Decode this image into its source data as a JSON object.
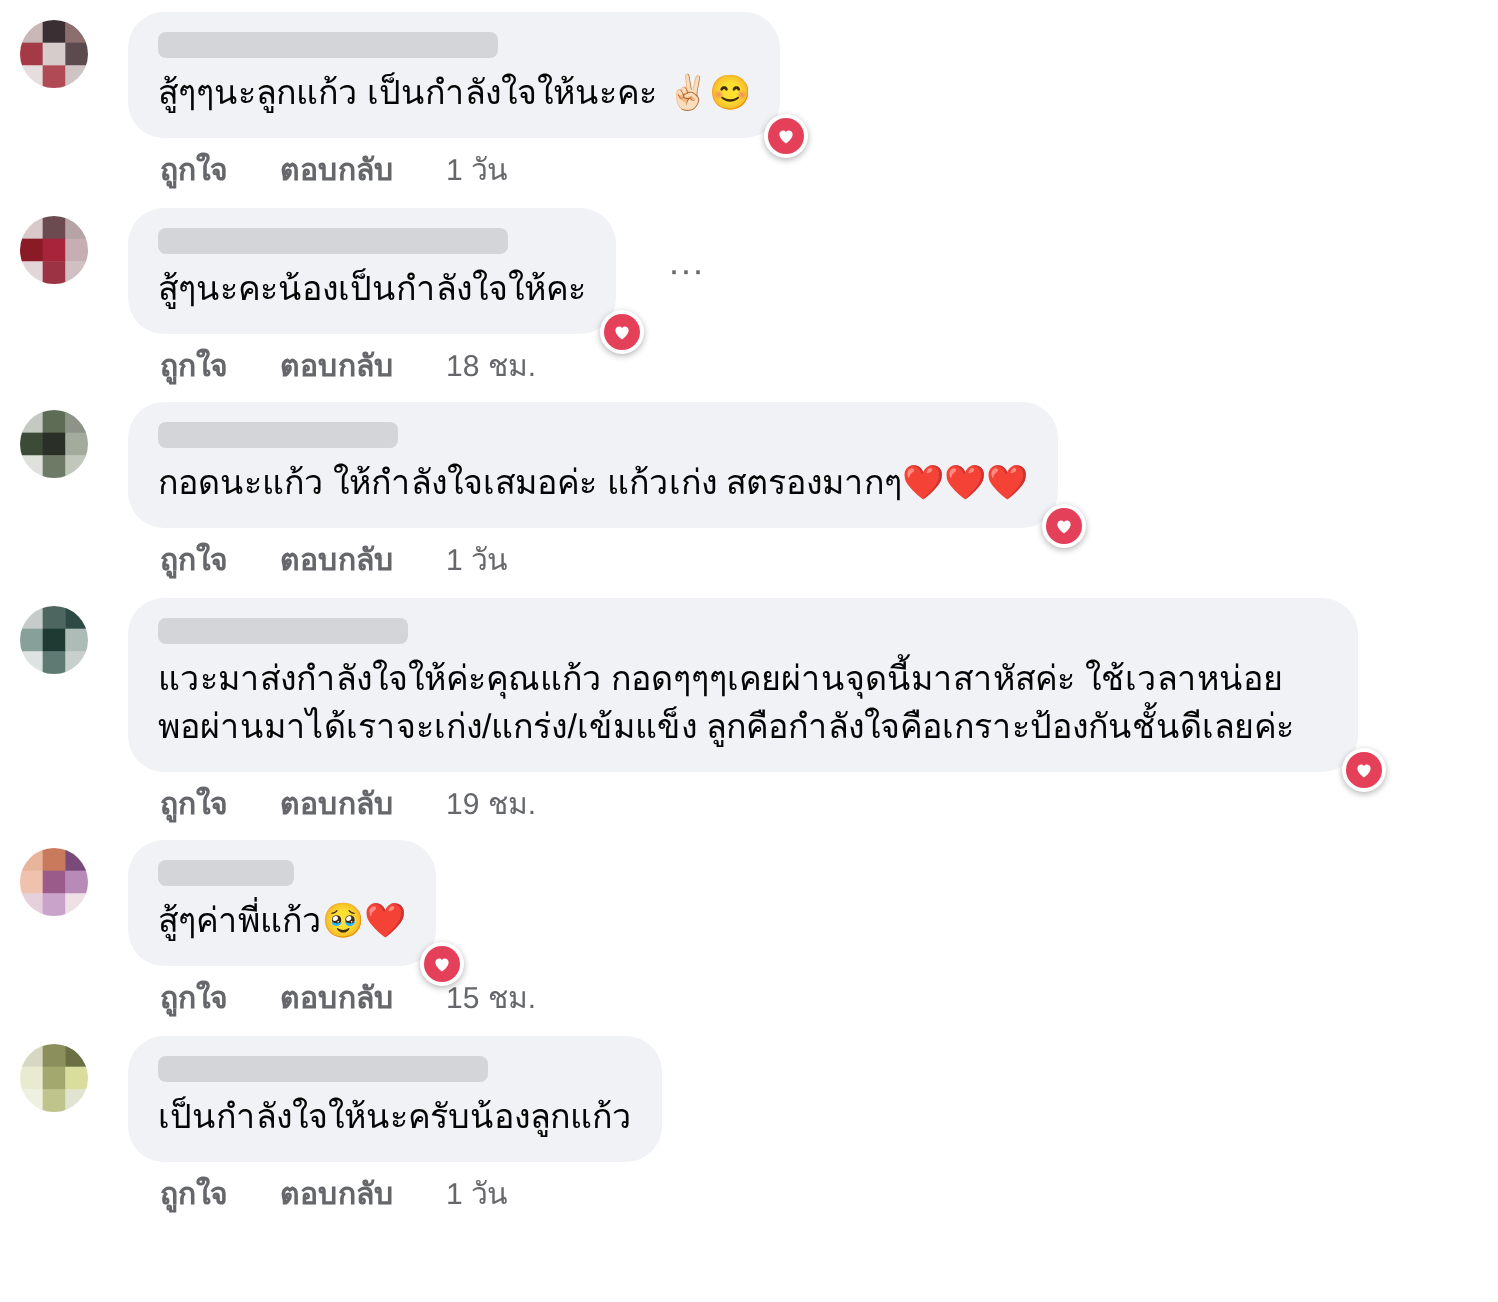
{
  "comments": [
    {
      "text": "สู้ๆๆนะลูกแก้ว เป็นกำลังใจให้นะคะ ✌🏻😊",
      "loved": true,
      "like": "ถูกใจ",
      "reply": "ตอบกลับ",
      "time": "1 วัน"
    },
    {
      "text": "สู้ๆนะคะน้องเป็นกำลังใจให้คะ",
      "loved": true,
      "more_menu": "···",
      "like": "ถูกใจ",
      "reply": "ตอบกลับ",
      "time": "18 ชม."
    },
    {
      "text": "กอดนะแก้ว ให้กำลังใจเสมอค่ะ แก้วเก่ง สตรองมากๆ❤️❤️❤️",
      "loved": true,
      "like": "ถูกใจ",
      "reply": "ตอบกลับ",
      "time": "1 วัน"
    },
    {
      "text": "แวะมาส่งกำลังใจให้ค่ะคุณแก้ว กอดๆๆๆเคยผ่านจุดนี้มาสาหัสค่ะ ใช้เวลาหน่อย พอผ่านมาได้เราจะเก่ง/แกร่ง/เข้มแข็ง ลูกคือกำลังใจคือเกราะป้องกันชั้นดีเลยค่ะ",
      "loved": true,
      "like": "ถูกใจ",
      "reply": "ตอบกลับ",
      "time": "19 ชม."
    },
    {
      "text": "สู้ๆค่าพี่แก้ว🥹❤️",
      "loved": true,
      "like": "ถูกใจ",
      "reply": "ตอบกลับ",
      "time": "15 ชม."
    },
    {
      "text": "เป็นกำลังใจให้นะครับน้องลูกแก้ว",
      "loved": false,
      "like": "ถูกใจ",
      "reply": "ตอบกลับ",
      "time": "1 วัน"
    }
  ]
}
